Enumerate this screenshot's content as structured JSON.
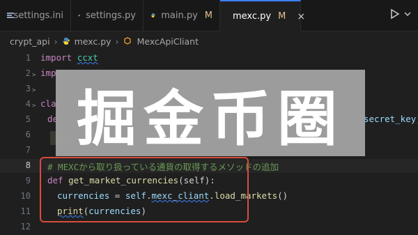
{
  "tabs": [
    {
      "label": "settings.ini",
      "modified": "",
      "icon": "settings-file-icon"
    },
    {
      "label": "settings.py",
      "modified": "",
      "icon": "python-icon"
    },
    {
      "label": "main.py",
      "modified": "M",
      "icon": "python-icon"
    },
    {
      "label": "mexc.py",
      "modified": "M",
      "icon": "python-icon",
      "active": true
    }
  ],
  "tab_close": "×",
  "breadcrumb": {
    "folder": "crypt_api",
    "file": "mexc.py",
    "symbol": "MexcApiCliant",
    "sep": "›"
  },
  "run_icon": "run-icon",
  "line_numbers": [
    "1",
    "2",
    "3",
    "4",
    "5",
    "6",
    "7",
    "8",
    "9",
    "10",
    "11",
    "12"
  ],
  "code": {
    "l1_kw": "import",
    "l1_mod": "ccxt",
    "l2_kw": "impo",
    "l4_kw": "clas",
    "l5_kw": "de",
    "l5_right": "secret_key):",
    "l8_comment": "# MEXCから取り扱っている通貨の取得するメソッドの追加",
    "l9_kw": "def",
    "l9_fn": "get_market_currencies",
    "l9_rest": "(self):",
    "l10_var": "currencies",
    "l10_eq": " = ",
    "l10_self": "self",
    "l10_attr": "mexc_cliant",
    "l10_fn": "load_markets",
    "l10_end": "()",
    "l11_fn": "print",
    "l11_arg": "currencies"
  },
  "overlay_text": "掘金币圈",
  "colors": {
    "accent": "#3b82f6",
    "highlight_box": "#d94c3d",
    "modified": "#e2c08d"
  }
}
